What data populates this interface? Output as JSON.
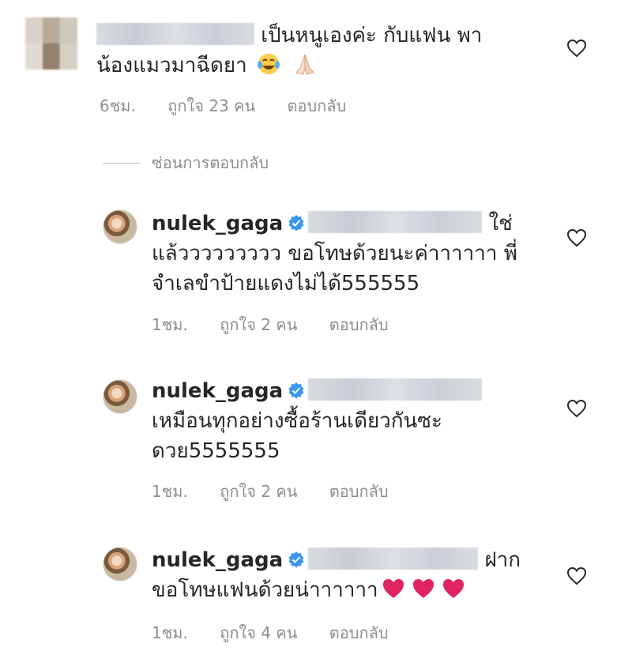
{
  "comments": [
    {
      "line1": "เป็นหนูเองค่ะ กับแฟน พา",
      "line2": "น้องแมวมาฉีดยา",
      "time": "6ชม.",
      "likes": "ถูกใจ 23 คน",
      "reply": "ตอบกลับ"
    },
    {
      "username": "nulek_gaga",
      "line1_tail": "ใช่",
      "line2": "แล้ววววววววว  ขอโทษด้วยนะค่าาาาาา พี่",
      "line3": "จำเลขำป้ายแดงไม่ได้555555",
      "time": "1ชม.",
      "likes": "ถูกใจ 2 คน",
      "reply": "ตอบกลับ"
    },
    {
      "username": "nulek_gaga",
      "line2": "เหมือนทุกอย่างซื้อร้านเดียวกันซะ",
      "line3": "ดวย5555555",
      "time": "1ชม.",
      "likes": "ถูกใจ 2 คน",
      "reply": "ตอบกลับ"
    },
    {
      "username": "nulek_gaga",
      "line1_tail": "ฝาก",
      "line2": "ขอโทษแฟนด้วยน่าาาาาา",
      "time": "1ชม.",
      "likes": "ถูกใจ 4 คน",
      "reply": "ตอบกลับ"
    }
  ],
  "hidden_replies_label": "ซ่อนการตอบกลับ",
  "icons": {
    "heart": "heart-outline-icon",
    "verified": "verified-badge-icon",
    "laugh": "tears-of-joy-emoji",
    "pray": "folded-hands-emoji",
    "red_heart": "red-heart-emoji"
  },
  "colors": {
    "verified": "#3897f0",
    "meta": "#8e8e8e",
    "text": "#262626",
    "red_heart": "#e0245e"
  }
}
